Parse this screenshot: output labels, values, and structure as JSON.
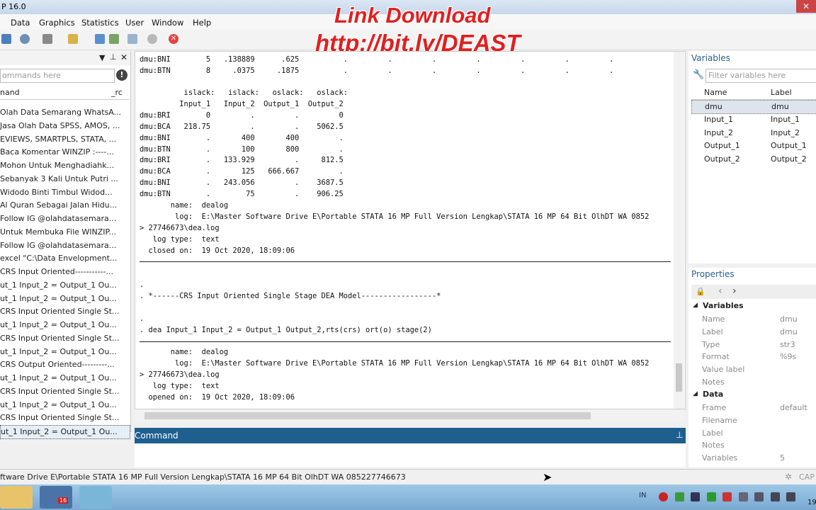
{
  "window": {
    "title": "P 16.0"
  },
  "menu": [
    "Data",
    "Graphics",
    "Statistics",
    "User",
    "Window",
    "Help"
  ],
  "watermark": {
    "line1": "Link Download",
    "line2": "http://bit.ly/DEAST"
  },
  "review": {
    "search_placeholder": "ommands here",
    "col_command": "nand",
    "col_rc": "_rc",
    "items": [
      "Olah Data Semarang WhatsA...",
      "Jasa Olah Data SPSS, AMOS, ...",
      "EVIEWS, SMARTPLS, STATA, ...",
      "Baca Komentar WINZIP :----...",
      "Mohon Untuk Menghadiahk...",
      "Sebanyak 3 Kali Untuk Putri ...",
      "Widodo Binti Timbul Widod...",
      "Al Quran Sebagai Jalan Hidu...",
      "Follow IG @olahdatasemara...",
      "Untuk Membuka File WINZIP...",
      "Follow IG @olahdatasemara...",
      "excel \"C:\\Data Envelopment...",
      "CRS Input Oriented-----------...",
      "ut_1 Input_2 = Output_1 Ou...",
      "ut_1 Input_2 = Output_1 Ou...",
      "CRS Input Oriented Single St...",
      "ut_1 Input_2 = Output_1 Ou...",
      "CRS Input Oriented Single St...",
      "ut_1 Input_2 = Output_1 Ou...",
      "CRS Output Oriented---------...",
      "ut_1 Input_2 = Output_1 Ou...",
      "CRS Input Oriented Single St...",
      "ut_1 Input_2 = Output_1 Ou...",
      "CRS Input Oriented Single St...",
      "ut_1 Input_2 = Output_1 Ou..."
    ]
  },
  "results": {
    "block1": "dmu:BNI        5   .138889      .625          .         .         .         .         .         .         .\ndmu:BTN        8     .0375     .1875          .         .         .         .         .         .         .",
    "block2": "          islack:   islack:   oslack:   oslack:\n         Input_1   Input_2  Output_1  Output_2\ndmu:BRI        0         .         .         0\ndmu:BCA   218.75         .         .    5062.5\ndmu:BNI        .       400       400         .\ndmu:BTN        .       100       800         .\ndmu:BRI        .   133.929         .     812.5\ndmu:BCA        .       125   666.667         .\ndmu:BNI        .   243.056         .    3687.5\ndmu:BTN        .        75         .    906.25\n       name:  dealog\n        log:  E:\\Master Software Drive E\\Portable STATA 16 MP Full Version Lengkap\\STATA 16 MP 64 Bit OlhDT WA 0852\n> 27746673\\dea.log\n   log type:  text\n  closed on:  19 Oct 2020, 18:09:06",
    "block3": ".\n. *------CRS Input Oriented Single Stage DEA Model-----------------*\n\n.\n. dea Input_1 Input_2 = Output_1 Output_2,rts(crs) ort(o) stage(2)",
    "block4": "       name:  dealog\n        log:  E:\\Master Software Drive E\\Portable STATA 16 MP Full Version Lengkap\\STATA 16 MP 64 Bit OlhDT WA 0852\n> 27746673\\dea.log\n   log type:  text\n  opened on:  19 Oct 2020, 18:09:06"
  },
  "command": {
    "title": "Command"
  },
  "variables": {
    "title": "Variables",
    "filter_placeholder": "Filter variables here",
    "col_name": "Name",
    "col_label": "Label",
    "rows": [
      {
        "name": "dmu",
        "label": "dmu"
      },
      {
        "name": "Input_1",
        "label": "Input_1"
      },
      {
        "name": "Input_2",
        "label": "Input_2"
      },
      {
        "name": "Output_1",
        "label": "Output_1"
      },
      {
        "name": "Output_2",
        "label": "Output_2"
      }
    ]
  },
  "properties": {
    "title": "Properties",
    "section_variables": "Variables",
    "var_props": [
      {
        "k": "Name",
        "v": "dmu"
      },
      {
        "k": "Label",
        "v": "dmu"
      },
      {
        "k": "Type",
        "v": "str3"
      },
      {
        "k": "Format",
        "v": "%9s"
      },
      {
        "k": "Value label",
        "v": ""
      },
      {
        "k": "Notes",
        "v": ""
      }
    ],
    "section_data": "Data",
    "data_props": [
      {
        "k": "Frame",
        "v": "default"
      },
      {
        "k": "Filename",
        "v": ""
      },
      {
        "k": "Label",
        "v": ""
      },
      {
        "k": "Notes",
        "v": ""
      },
      {
        "k": "Variables",
        "v": "5"
      }
    ]
  },
  "status": {
    "path": "ftware Drive E\\Portable STATA 16 MP Full Version Lengkap\\STATA 16 MP 64 Bit OlhDT WA 085227746673",
    "cap": "CAP"
  },
  "taskbar": {
    "lang": "IN",
    "stata_badge": "16",
    "clock": "19"
  }
}
